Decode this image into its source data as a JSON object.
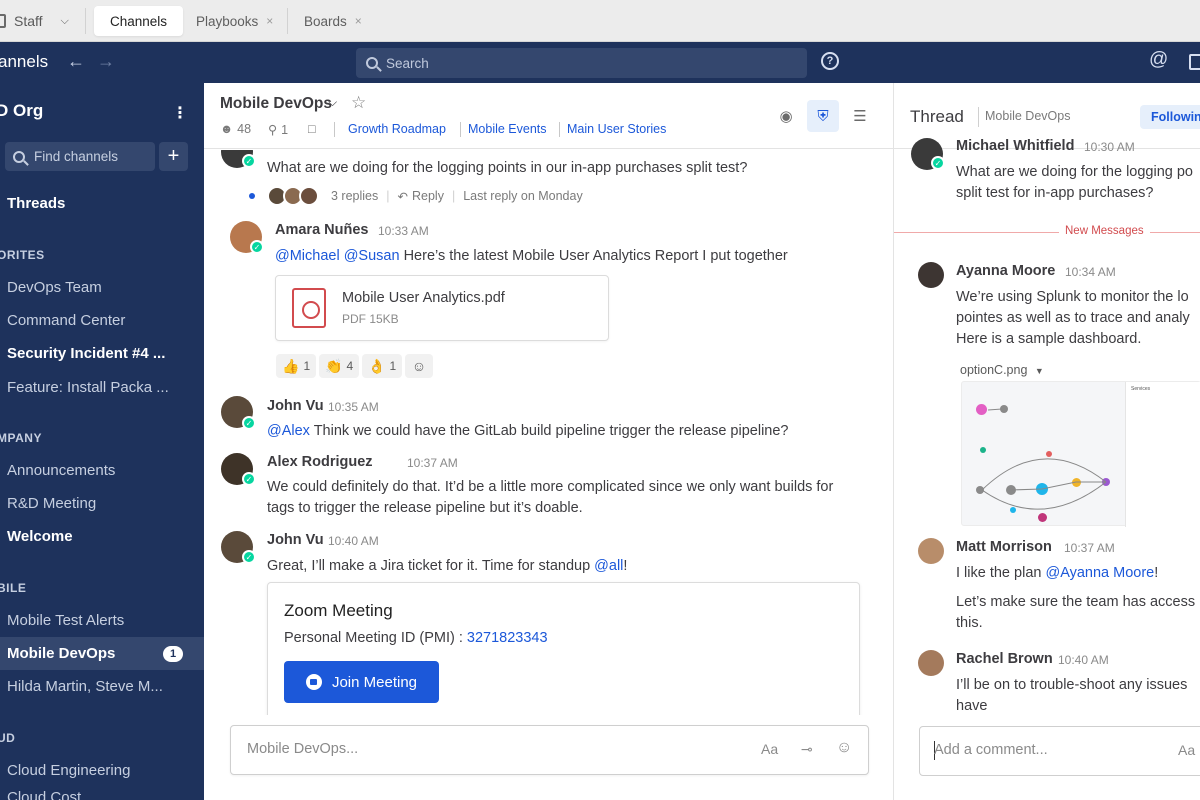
{
  "tabstrip": {
    "team": "Staff",
    "tabs": [
      {
        "label": "Channels",
        "active": true
      },
      {
        "label": "Playbooks",
        "close": "×"
      },
      {
        "label": "Boards",
        "close": "×"
      }
    ]
  },
  "header": {
    "title": "annels",
    "search_placeholder": "Search",
    "help_icon": "?"
  },
  "sidebar": {
    "org": "D Org",
    "find_placeholder": "Find channels",
    "add_symbol": "+",
    "threads": "Threads",
    "categories": [
      "ORITES",
      "MPANY",
      "BILE",
      "UD"
    ],
    "items": [
      {
        "label": "DevOps Team"
      },
      {
        "label": "Command Center"
      },
      {
        "label": "Security Incident #4 ..."
      },
      {
        "label": "Feature: Install Packa ..."
      },
      {
        "label": "Announcements"
      },
      {
        "label": "R&D Meeting"
      },
      {
        "label": "Welcome"
      },
      {
        "label": "Mobile Test Alerts"
      },
      {
        "label": "Mobile DevOps",
        "badge": "1"
      },
      {
        "label": "Hilda Martin, Steve M..."
      },
      {
        "label": "Cloud Engineering"
      },
      {
        "label": "Cloud Cost..."
      }
    ]
  },
  "channel": {
    "name": "Mobile DevOps",
    "members": "48",
    "pinned": "1",
    "bookmarks": [
      "Growth Roadmap",
      "Mobile Events",
      "Main User Stories"
    ]
  },
  "feed": {
    "root_text": "What are we doing for the logging points in our in-app purchases split test?",
    "replies": "3 replies",
    "reply": "Reply",
    "last_reply": "Last reply on Monday",
    "messages": [
      {
        "name": "Amara Nuñes",
        "time": "10:33 AM",
        "mention": "@Michael @Susan",
        "text": " Here’s the latest Mobile User Analytics Report I put together"
      },
      {
        "name": "John Vu",
        "time": "10:35 AM",
        "mention": "@Alex",
        "text": " Think we could have the GitLab build pipeline trigger the release pipeline?"
      },
      {
        "name": "Alex Rodriguez",
        "time": "10:37 AM",
        "line1": "We could definitely do that. It’d be a little more complicated since we only want builds for",
        "line2": "tags to trigger the release pipeline but it’s doable."
      },
      {
        "name": "John Vu",
        "time": "10:40 AM",
        "text": "Great, I’ll make a Jira ticket for it. Time for standup ",
        "mention": "@all",
        "tail": "!"
      }
    ],
    "file": {
      "name": "Mobile User Analytics.pdf",
      "size": "PDF 15KB"
    },
    "reactions": [
      {
        "emoji": "👍",
        "count": "1"
      },
      {
        "emoji": "👏",
        "count": "4"
      },
      {
        "emoji": "👌",
        "count": "1"
      }
    ],
    "zoom": {
      "title": "Zoom Meeting",
      "id_label": "Personal Meeting ID (PMI) : ",
      "id": "3271823343",
      "button": "Join Meeting"
    }
  },
  "composer": {
    "placeholder": "Mobile DevOps...",
    "format": "Aa"
  },
  "thread": {
    "title": "Thread",
    "channel": "Mobile DevOps",
    "follow": "Following",
    "root_name": "Michael Whitfield",
    "root_time": "10:30 AM",
    "root_line1": "What are we doing for the logging po",
    "root_line2": "split test for in-app purchases?",
    "new_messages": "New Messages",
    "messages": [
      {
        "name": "Ayanna Moore",
        "time": "10:34 AM",
        "line1": "We’re using Splunk to monitor the lo",
        "line2": "pointes as well as to trace and analy",
        "line3": "Here is a sample dashboard."
      },
      {
        "name": "Matt Morrison",
        "time": "10:37 AM",
        "text": "I like the plan ",
        "mention": "@Ayanna Moore",
        "tail": "!",
        "line2": "Let’s make sure the team has access",
        "line3": "this."
      },
      {
        "name": "Rachel Brown",
        "time": "10:40 AM",
        "line1": "I’ll be on to trouble-shoot any issues",
        "line2": "have"
      }
    ],
    "attachment": "optionC.png",
    "shot_title": "Services",
    "composer_placeholder": "Add a comment...",
    "format": "Aa"
  },
  "colors": {
    "sidebar": "#1e325c",
    "accent": "#1c58d9",
    "online": "#06d6a0",
    "new_messages": "#d24b4e"
  }
}
